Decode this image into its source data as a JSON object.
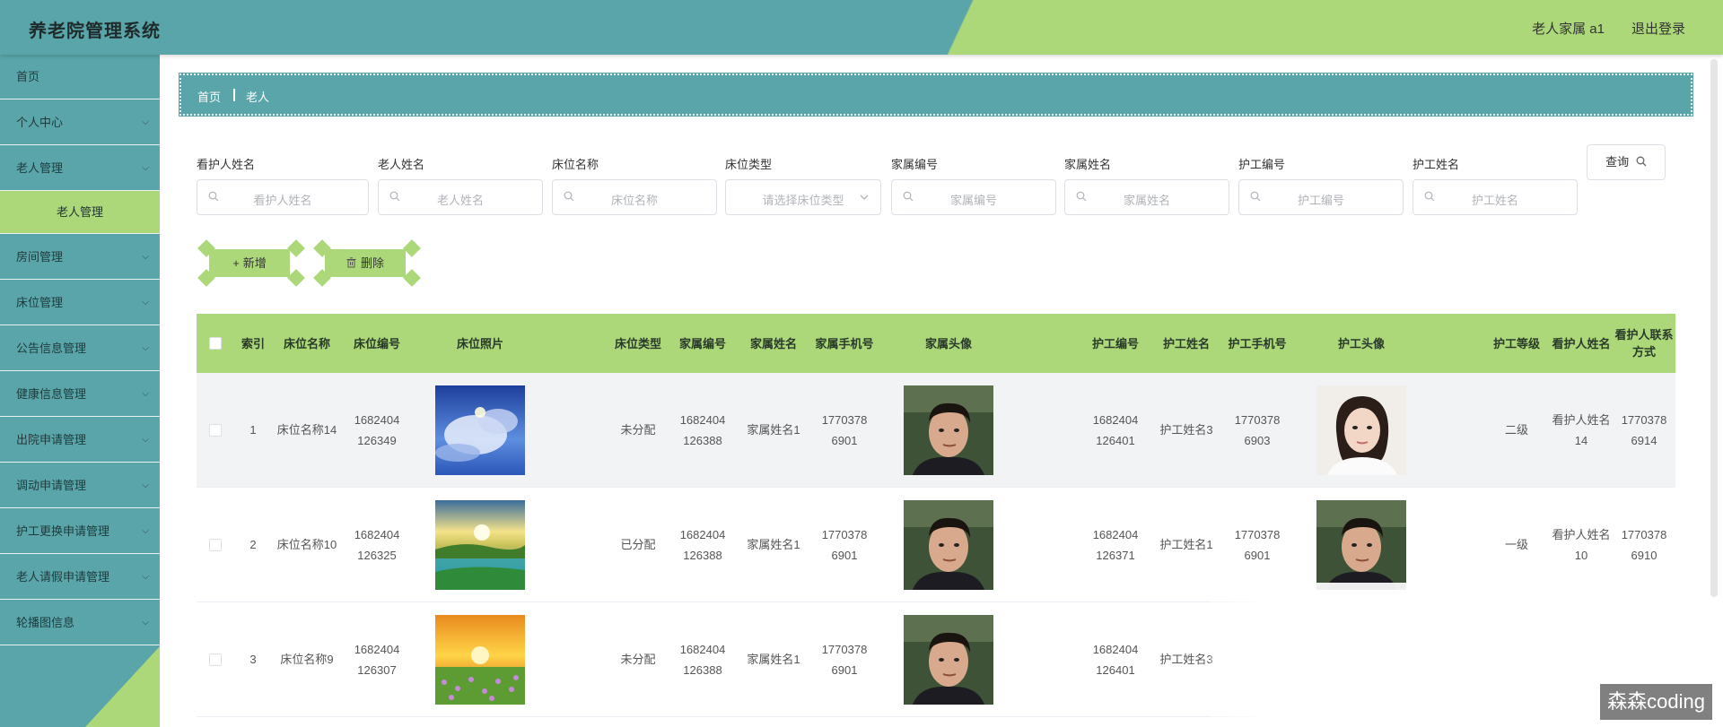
{
  "header": {
    "title": "养老院管理系统",
    "user": "老人家属 a1",
    "logout": "退出登录"
  },
  "sidebar": {
    "items": [
      {
        "label": "首页"
      },
      {
        "label": "个人中心"
      },
      {
        "label": "老人管理"
      },
      {
        "label": "老人管理",
        "sub": true
      },
      {
        "label": "房间管理"
      },
      {
        "label": "床位管理"
      },
      {
        "label": "公告信息管理"
      },
      {
        "label": "健康信息管理"
      },
      {
        "label": "出院申请管理"
      },
      {
        "label": "调动申请管理"
      },
      {
        "label": "护工更换申请管理"
      },
      {
        "label": "老人请假申请管理"
      },
      {
        "label": "轮播图信息"
      }
    ]
  },
  "breadcrumb": {
    "home": "首页",
    "current": "老人"
  },
  "search": {
    "fields": [
      {
        "label": "看护人姓名",
        "placeholder": "看护人姓名"
      },
      {
        "label": "老人姓名",
        "placeholder": "老人姓名"
      },
      {
        "label": "床位名称",
        "placeholder": "床位名称"
      },
      {
        "label": "床位类型",
        "placeholder": "请选择床位类型"
      },
      {
        "label": "家属编号",
        "placeholder": "家属编号"
      },
      {
        "label": "家属姓名",
        "placeholder": "家属姓名"
      },
      {
        "label": "护工编号",
        "placeholder": "护工编号"
      },
      {
        "label": "护工姓名",
        "placeholder": "护工姓名"
      }
    ],
    "query_label": "查询"
  },
  "actions": {
    "add": "新增",
    "delete": "删除"
  },
  "table": {
    "columns": [
      "索引",
      "床位名称",
      "床位编号",
      "床位照片",
      "床位类型",
      "家属编号",
      "家属姓名",
      "家属手机号",
      "家属头像",
      "护工编号",
      "护工姓名",
      "护工手机号",
      "护工头像",
      "护工等级",
      "看护人姓名",
      "看护人联系方式"
    ],
    "rows": [
      {
        "index": "1",
        "bed_name": "床位名称14",
        "bed_no": "1682404126349",
        "bed_photo": "sky",
        "bed_type": "未分配",
        "family_no": "1682404126388",
        "family_name": "家属姓名1",
        "family_phone": "17703786901",
        "family_avatar": "man",
        "nurse_no": "1682404126401",
        "nurse_name": "护工姓名3",
        "nurse_phone": "17703786903",
        "nurse_avatar": "woman",
        "nurse_level": "二级",
        "guardian_name": "看护人姓名14",
        "guardian_phone": "17703786914"
      },
      {
        "index": "2",
        "bed_name": "床位名称10",
        "bed_no": "1682404126325",
        "bed_photo": "lake",
        "bed_type": "已分配",
        "family_no": "1682404126388",
        "family_name": "家属姓名1",
        "family_phone": "17703786901",
        "family_avatar": "man",
        "nurse_no": "1682404126371",
        "nurse_name": "护工姓名1",
        "nurse_phone": "17703786901",
        "nurse_avatar": "man",
        "nurse_level": "一级",
        "guardian_name": "看护人姓名10",
        "guardian_phone": "17703786910"
      },
      {
        "index": "3",
        "bed_name": "床位名称9",
        "bed_no": "1682404126307",
        "bed_photo": "field",
        "bed_type": "未分配",
        "family_no": "1682404126388",
        "family_name": "家属姓名1",
        "family_phone": "17703786901",
        "family_avatar": "man",
        "nurse_no": "1682404126401",
        "nurse_name": "护工姓名3",
        "nurse_phone": "",
        "nurse_avatar": "",
        "nurse_level": "",
        "guardian_name": "",
        "guardian_phone": ""
      }
    ]
  },
  "watermark": "森森coding",
  "colors": {
    "primary": "#5aa5a9",
    "accent": "#acd879"
  }
}
